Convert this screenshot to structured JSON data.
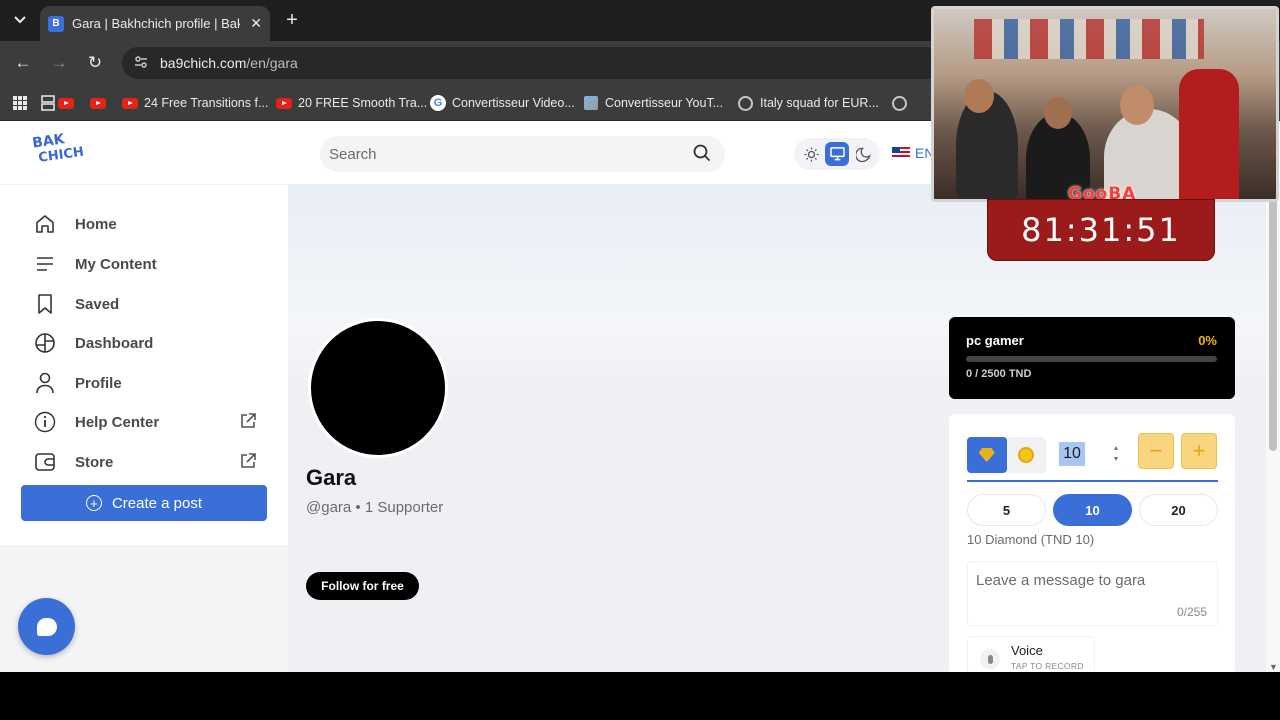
{
  "browser": {
    "tab_title": "Gara | Bakhchich profile | Bakhchich",
    "url_host": "ba9chich.com",
    "url_path": "/en/gara",
    "bookmarks": [
      {
        "icon": "youtube-icon",
        "label": ""
      },
      {
        "icon": "youtube-icon",
        "label": ""
      },
      {
        "icon": "youtube-icon",
        "label": "24 Free Transitions f..."
      },
      {
        "icon": "youtube-icon",
        "label": "20 FREE Smooth Tra..."
      },
      {
        "icon": "google-icon",
        "label": "Convertisseur Video..."
      },
      {
        "icon": "site-icon",
        "label": "Convertisseur YouT..."
      },
      {
        "icon": "globe-icon",
        "label": "Italy squad for EUR..."
      },
      {
        "icon": "globe-icon",
        "label": ""
      }
    ]
  },
  "header": {
    "logo_line1": "BAK",
    "logo_line2": "CHICH",
    "search_placeholder": "Search",
    "language": "EN"
  },
  "sidebar": {
    "items": [
      {
        "label": "Home",
        "icon": "home-icon"
      },
      {
        "label": "My Content",
        "icon": "list-icon"
      },
      {
        "label": "Saved",
        "icon": "bookmark-icon"
      },
      {
        "label": "Dashboard",
        "icon": "dashboard-icon"
      },
      {
        "label": "Profile",
        "icon": "user-icon"
      },
      {
        "label": "Help Center",
        "icon": "info-icon"
      },
      {
        "label": "Store",
        "icon": "wallet-icon"
      }
    ],
    "create_post": "Create a post"
  },
  "profile": {
    "name": "Gara",
    "handle": "@gara",
    "separator": "•",
    "supporters": "1 Supporter",
    "follow_label": "Follow for free"
  },
  "goal": {
    "title": "pc gamer",
    "percent_label": "0%",
    "progress": 0,
    "amount": "0 / 2500 TND",
    "accent": "#f5b301"
  },
  "tip": {
    "amount_value": "10",
    "presets": [
      "5",
      "10",
      "20"
    ],
    "selected_preset": "10",
    "summary": "10 Diamond (TND 10)",
    "message_placeholder": "Leave a message to gara",
    "message_count": "0/255",
    "voice_label": "Voice",
    "voice_sub": "TAP TO RECORD",
    "minus": "−",
    "plus": "+"
  },
  "overlay": {
    "stream_logo": "GooBA",
    "timer": "81:31:51"
  },
  "colors": {
    "brand_blue": "#3b6fd8",
    "timer_red": "#9b1b1b",
    "step_yellow": "#f8d57e"
  }
}
